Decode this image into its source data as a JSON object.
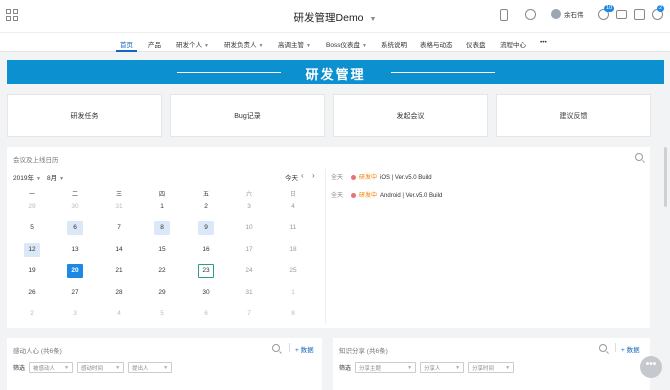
{
  "app": {
    "title": "研发管理Demo",
    "caret": "▼",
    "user_name": "余石伟",
    "badges": {
      "notifications": "10",
      "messages": "2"
    }
  },
  "nav": [
    {
      "label": "首页",
      "active": true,
      "chevron": false
    },
    {
      "label": "产品",
      "active": false,
      "chevron": false
    },
    {
      "label": "研发个人",
      "active": false,
      "chevron": true
    },
    {
      "label": "研发负责人",
      "active": false,
      "chevron": true
    },
    {
      "label": "高调主管",
      "active": false,
      "chevron": true
    },
    {
      "label": "Boss仪表盘",
      "active": false,
      "chevron": true
    },
    {
      "label": "系统说明",
      "active": false,
      "chevron": false
    },
    {
      "label": "表格与动态",
      "active": false,
      "chevron": false
    },
    {
      "label": "仪表盘",
      "active": false,
      "chevron": false
    },
    {
      "label": "流程中心",
      "active": false,
      "chevron": false
    },
    {
      "label": "•••",
      "active": false,
      "chevron": false
    }
  ],
  "banner": {
    "title": "研发管理",
    "color": "#0c90d0"
  },
  "quick_actions": [
    "研发任务",
    "Bug记录",
    "发起会议",
    "建议反馈"
  ],
  "calendar_panel": {
    "title": "会议及上线日历",
    "year": "2019年",
    "month": "8月",
    "today_label": "今天",
    "prev": "‹",
    "next": "›",
    "weekdays": [
      "一",
      "二",
      "三",
      "四",
      "五",
      "六",
      "日"
    ],
    "weeks": [
      [
        "29",
        "30",
        "31",
        "1",
        "2",
        "3",
        "4"
      ],
      [
        "5",
        "6",
        "7",
        "8",
        "9",
        "10",
        "11"
      ],
      [
        "12",
        "13",
        "14",
        "15",
        "16",
        "17",
        "18"
      ],
      [
        "19",
        "20",
        "21",
        "22",
        "23",
        "24",
        "25"
      ],
      [
        "26",
        "27",
        "28",
        "29",
        "30",
        "31",
        "1"
      ],
      [
        "2",
        "3",
        "4",
        "5",
        "6",
        "7",
        "8"
      ]
    ],
    "events": [
      {
        "allday": "全天",
        "status": "研发中",
        "text": "iOS | Ver.v5.0 Build"
      },
      {
        "allday": "全天",
        "status": "研发中",
        "text": "Android | Ver.v5.0 Build"
      }
    ]
  },
  "panel_left": {
    "title": "感动人心 (共6条)",
    "add_label": "+ 数据",
    "filter_label": "筛选",
    "filters": [
      "被感动人",
      "感动时间",
      "提出人"
    ]
  },
  "panel_right": {
    "title": "知识分享 (共6条)",
    "add_label": "+ 数据",
    "filter_label": "筛选",
    "filters": [
      "分享主题",
      "分享人",
      "分享时间"
    ]
  },
  "fab": {
    "label": "•••"
  }
}
